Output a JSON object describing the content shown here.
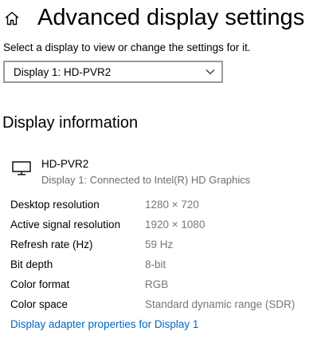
{
  "header": {
    "home_icon": "home-icon",
    "title": "Advanced display settings"
  },
  "instruction": "Select a display to view or change the settings for it.",
  "display_select": {
    "selected": "Display 1: HD-PVR2",
    "icon": "chevron-down-icon"
  },
  "display_information": {
    "title": "Display information",
    "monitor": {
      "icon": "monitor-icon",
      "name": "HD-PVR2",
      "connection": "Display 1: Connected to Intel(R) HD Graphics"
    },
    "rows": [
      {
        "label": "Desktop resolution",
        "value": "1280 × 720"
      },
      {
        "label": "Active signal resolution",
        "value": "1920 × 1080"
      },
      {
        "label": "Refresh rate (Hz)",
        "value": "59 Hz"
      },
      {
        "label": "Bit depth",
        "value": "8-bit"
      },
      {
        "label": "Color format",
        "value": "RGB"
      },
      {
        "label": "Color space",
        "value": "Standard dynamic range (SDR)"
      }
    ]
  },
  "adapter_link": "Display adapter properties for Display 1",
  "colors": {
    "link": "#0067c0",
    "secondary_text": "#777777",
    "select_border": "#9a9a9a"
  }
}
